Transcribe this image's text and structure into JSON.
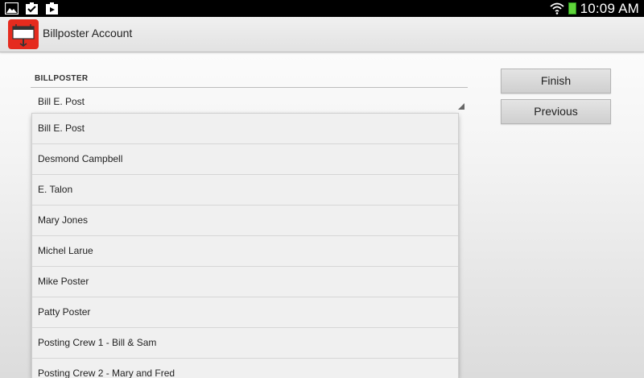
{
  "status_bar": {
    "time": "10:09 AM",
    "notification_icons": [
      "gallery-icon",
      "clipboard-check-icon",
      "video-clipboard-icon"
    ],
    "wifi_icon": "wifi-icon",
    "battery_icon": "battery-icon"
  },
  "action_bar": {
    "app_icon": "billposter-app-icon",
    "title": "Billposter Account"
  },
  "form": {
    "section_label": "BILLPOSTER",
    "selected_value": "Bill E. Post"
  },
  "buttons": {
    "finish_label": "Finish",
    "previous_label": "Previous"
  },
  "dropdown": {
    "items": [
      "Bill E. Post",
      "Desmond Campbell",
      "E. Talon",
      "Mary Jones",
      "Michel Larue",
      "Mike Poster",
      "Patty Poster",
      "Posting Crew 1 - Bill & Sam",
      "Posting Crew 2 - Mary and Fred"
    ]
  },
  "colors": {
    "app_icon_red": "#e52b1e",
    "battery_green": "#5fd53a",
    "status_bar_bg": "#000000"
  }
}
